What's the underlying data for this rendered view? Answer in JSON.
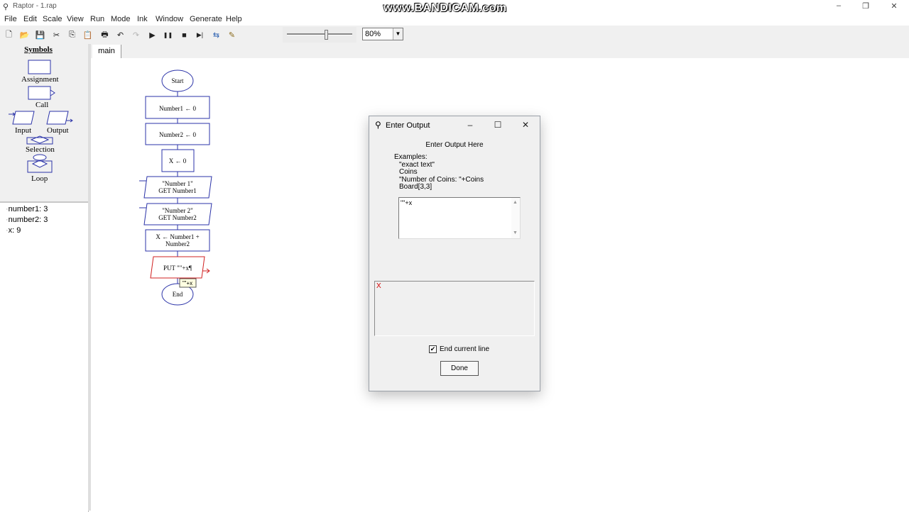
{
  "window": {
    "title": "Raptor - 1.rap",
    "watermark": "www.BANDICAM.com",
    "controls": {
      "minimize": "–",
      "maximize": "❐",
      "close": "✕"
    }
  },
  "menu": [
    "File",
    "Edit",
    "Scale",
    "View",
    "Run",
    "Mode",
    "Ink",
    "Window",
    "Generate",
    "Help"
  ],
  "toolbar": {
    "buttons": [
      {
        "name": "new-icon",
        "glyph": "🗋"
      },
      {
        "name": "open-icon",
        "glyph": "📂"
      },
      {
        "name": "save-icon",
        "glyph": "💾"
      },
      {
        "name": "cut-icon",
        "glyph": "✂"
      },
      {
        "name": "copy-icon",
        "glyph": "⎘"
      },
      {
        "name": "paste-icon",
        "glyph": "📋"
      },
      {
        "name": "print-icon",
        "glyph": "🖶"
      },
      {
        "name": "undo-icon",
        "glyph": "↶"
      },
      {
        "name": "redo-icon",
        "glyph": "↷"
      },
      {
        "name": "execute-icon",
        "glyph": "▶"
      },
      {
        "name": "pause-icon",
        "glyph": "❚❚"
      },
      {
        "name": "stop-icon",
        "glyph": "■"
      },
      {
        "name": "step-icon",
        "glyph": "▶|"
      },
      {
        "name": "test-server-icon",
        "glyph": "⇆"
      },
      {
        "name": "ink-pen-icon",
        "glyph": "✎"
      }
    ],
    "zoom": "80%",
    "speed_fraction": 0.6
  },
  "symbols": {
    "header": "Symbols",
    "assignment": "Assignment",
    "call": "Call",
    "input": "Input",
    "output": "Output",
    "selection": "Selection",
    "loop": "Loop"
  },
  "watch": [
    {
      "text": "number1: 3"
    },
    {
      "text": "number2: 3"
    },
    {
      "text": "x: 9"
    }
  ],
  "tab": "main",
  "flowchart": {
    "start": "Start",
    "assign1": "Number1 ← 0",
    "assign2": "Number2 ← 0",
    "assign3": "X ← 0",
    "input1_prompt": "\"Number 1\"",
    "input1_get": "GET Number1",
    "input2_prompt": "\"Number 2\"",
    "input2_get": "GET Number2",
    "assign4_line1": "X ← Number1 +",
    "assign4_line2": "Number2",
    "output": "PUT \"\"+x¶",
    "tooltip": "\"\"+x",
    "end": "End"
  },
  "dialog": {
    "title": "Enter Output",
    "heading": "Enter Output Here",
    "examples_label": "Examples:",
    "examples": [
      "\"exact text\"",
      "Coins",
      "\"Number of Coins: \"+Coins",
      "Board[3,3]"
    ],
    "input_value": "\"\"+x",
    "error_mark": "X",
    "checkbox_label": "End current line",
    "checkbox_checked": true,
    "done_label": "Done"
  }
}
